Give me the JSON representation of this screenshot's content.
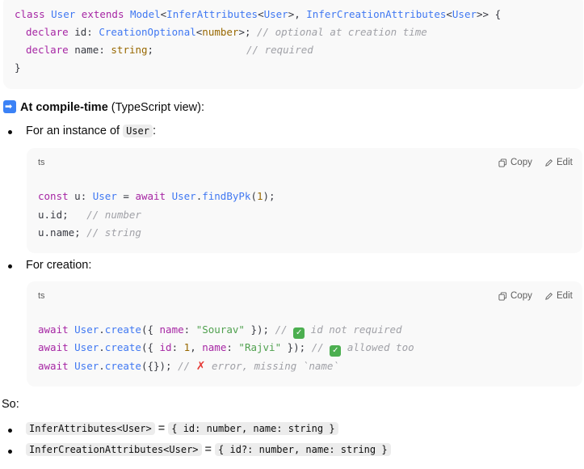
{
  "top_code": {
    "l1": {
      "a": "class ",
      "b": "User",
      "c": " extends ",
      "d": "Model",
      "e": "<",
      "f": "InferAttributes",
      "g": "<",
      "h": "User",
      "i": ">, ",
      "j": "InferCreationAttributes",
      "k": "<",
      "l": "User",
      "m": ">> {"
    },
    "l2": {
      "a": "declare ",
      "b": "id",
      "c": ": ",
      "d": "CreationOptional",
      "e": "<",
      "f": "number",
      "g": ">; ",
      "h": "// optional at creation time"
    },
    "l3": {
      "a": "declare ",
      "b": "name",
      "c": ": ",
      "d": "string",
      "e": ";",
      "f": "// required"
    },
    "l4": "}"
  },
  "section_title": {
    "bold": "At compile-time",
    "rest": " (TypeScript view):"
  },
  "bullet1": {
    "text": "For an instance of ",
    "code": "User",
    "after": ":"
  },
  "block1": {
    "lang": "ts",
    "copy": "Copy",
    "edit": "Edit",
    "l1": {
      "a": "const ",
      "b": "u",
      "c": ": ",
      "d": "User",
      "e": " = ",
      "f": "await ",
      "g": "User",
      "h": ".",
      "i": "findByPk",
      "j": "(",
      "k": "1",
      "l": ");"
    },
    "l2": {
      "a": "u.id;",
      "b": "   ",
      "c": "// number"
    },
    "l3": {
      "a": "u.name; ",
      "b": "// string"
    }
  },
  "bullet2": {
    "text": "For creation:"
  },
  "block2": {
    "lang": "ts",
    "copy": "Copy",
    "edit": "Edit",
    "l1": {
      "a": "await ",
      "b": "User",
      "c": ".",
      "d": "create",
      "e": "({ ",
      "f": "name",
      "g": ": ",
      "h": "\"Sourav\"",
      "i": " }); ",
      "j": "// ",
      "k": "✓",
      "l": " id not required"
    },
    "l2": {
      "a": "await ",
      "b": "User",
      "c": ".",
      "d": "create",
      "e": "({ ",
      "f": "id",
      "g": ": ",
      "h": "1",
      "i": ", ",
      "j": "name",
      "k": ": ",
      "l": "\"Rajvi\"",
      "m": " }); ",
      "n": "// ",
      "o": "✓",
      "p": " allowed too"
    },
    "l3": {
      "a": "await ",
      "b": "User",
      "c": ".",
      "d": "create",
      "e": "({}); ",
      "f": "// ",
      "g": "✗",
      "h": " error, missing `name`"
    }
  },
  "so_label": "So:",
  "bullet3": {
    "code1": "InferAttributes<User>",
    "eq": " = ",
    "code2": "{ id: number, name: string }"
  },
  "bullet4": {
    "code1": "InferCreationAttributes<User>",
    "eq": " = ",
    "code2": "{ id?: number, name: string }"
  }
}
